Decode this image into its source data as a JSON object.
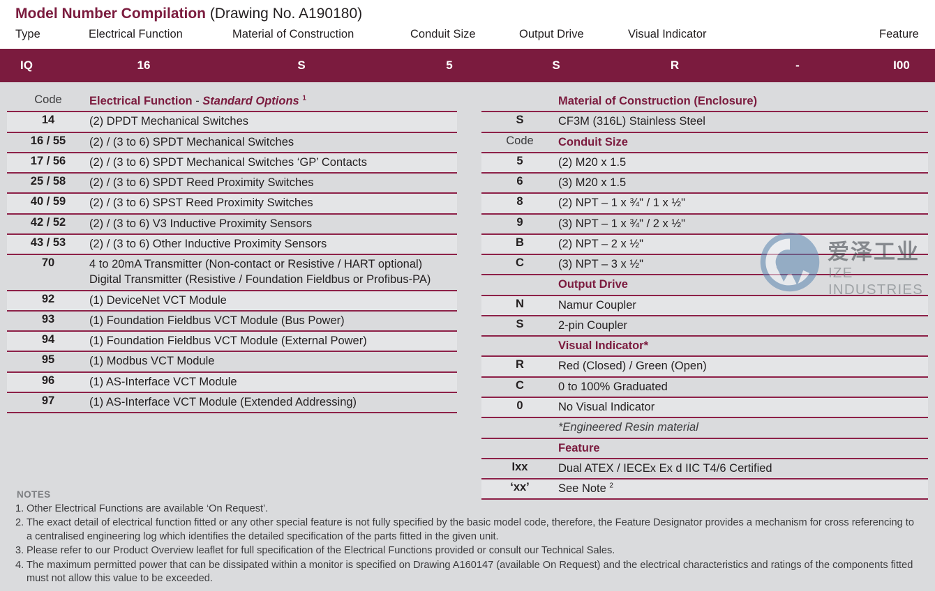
{
  "header": {
    "title_main": "Model Number Compilation",
    "title_sub": "(Drawing No. A190180)",
    "columns": [
      {
        "label": "Type",
        "code": "IQ"
      },
      {
        "label": "Electrical Function",
        "code": "16"
      },
      {
        "label": "Material of Construction",
        "code": "S"
      },
      {
        "label": "Conduit Size",
        "code": "5"
      },
      {
        "label": "Output Drive",
        "code": "S"
      },
      {
        "label": "Visual Indicator",
        "code": "R"
      },
      {
        "label": "",
        "code": "-"
      },
      {
        "label": "Feature",
        "code": "I00"
      }
    ]
  },
  "left_table": {
    "code_label": "Code",
    "section_title": "Electrical Function",
    "section_dash": " - ",
    "section_italic": "Standard Options",
    "section_footnote": "1",
    "rows": [
      {
        "code": "14",
        "desc": "(2) DPDT Mechanical Switches"
      },
      {
        "code": "16 / 55",
        "desc": "(2) / (3 to 6) SPDT Mechanical Switches"
      },
      {
        "code": "17 / 56",
        "desc": "(2) / (3 to 6) SPDT Mechanical Switches ‘GP’ Contacts"
      },
      {
        "code": "25 / 58",
        "desc": "(2) / (3 to 6) SPDT Reed Proximity Switches"
      },
      {
        "code": "40 / 59",
        "desc": "(2) / (3 to 6) SPST Reed Proximity Switches"
      },
      {
        "code": "42 / 52",
        "desc": "(2) / (3 to 6) V3 Inductive Proximity Sensors"
      },
      {
        "code": "43 / 53",
        "desc": "(2) / (3 to 6) Other Inductive Proximity Sensors"
      },
      {
        "code": "70",
        "desc": "4 to 20mA Transmitter (Non-contact or Resistive / HART optional)\nDigital Transmitter (Resistive / Foundation Fieldbus or Profibus-PA)"
      },
      {
        "code": "92",
        "desc": "(1) DeviceNet VCT Module"
      },
      {
        "code": "93",
        "desc": "(1) Foundation Fieldbus VCT Module (Bus Power)"
      },
      {
        "code": "94",
        "desc": "(1) Foundation Fieldbus VCT Module (External Power)"
      },
      {
        "code": "95",
        "desc": "(1) Modbus VCT Module"
      },
      {
        "code": "96",
        "desc": "(1) AS-Interface VCT Module"
      },
      {
        "code": "97",
        "desc": "(1) AS-Interface VCT Module (Extended Addressing)"
      }
    ]
  },
  "right_table": {
    "code_label": "Code",
    "sections": [
      {
        "title": "Material of Construction (Enclosure)",
        "rows": [
          {
            "code": "S",
            "desc": "CF3M (316L) Stainless Steel"
          }
        ]
      },
      {
        "title": "Conduit Size",
        "show_code_label": true,
        "rows": [
          {
            "code": "5",
            "desc": "(2) M20 x 1.5"
          },
          {
            "code": "6",
            "desc": "(3) M20 x 1.5"
          },
          {
            "code": "8",
            "desc": "(2) NPT – 1 x ¾\" / 1 x ½\""
          },
          {
            "code": "9",
            "desc": "(3) NPT – 1 x ¾\" / 2 x ½\""
          },
          {
            "code": "B",
            "desc": "(2) NPT – 2 x ½\""
          },
          {
            "code": "C",
            "desc": "(3) NPT – 3 x ½\""
          }
        ]
      },
      {
        "title": "Output Drive",
        "rows": [
          {
            "code": "N",
            "desc": "Namur Coupler"
          },
          {
            "code": "S",
            "desc": "2-pin Coupler"
          }
        ]
      },
      {
        "title": "Visual Indicator",
        "title_star": "*",
        "rows": [
          {
            "code": "R",
            "desc": "Red (Closed) / Green (Open)"
          },
          {
            "code": "C",
            "desc": "0 to 100% Graduated"
          },
          {
            "code": "0",
            "desc": "No Visual Indicator"
          }
        ],
        "footer_italic": "*Engineered Resin material"
      },
      {
        "title": "Feature",
        "rows": [
          {
            "code": "Ixx",
            "desc": "Dual ATEX / IECEx Ex d IIC T4/6 Certified"
          },
          {
            "code": "‘xx’",
            "desc": "See Note ",
            "desc_sup": "2"
          }
        ]
      }
    ]
  },
  "notes": {
    "heading": "NOTES",
    "items": [
      {
        "num": "1.",
        "text": "Other Electrical Functions are available ‘On Request’."
      },
      {
        "num": "2.",
        "text": "The exact detail of electrical function fitted or any other special feature is not fully specified by the basic model code, therefore, the Feature Designator provides a mechanism for cross referencing to a centralised engineering log which identifies the detailed specification of the parts fitted in the given unit."
      },
      {
        "num": "3.",
        "text": "Please refer to our Product Overview leaflet for full specification of the Electrical Functions provided or consult our Technical Sales."
      },
      {
        "num": "4.",
        "text": "The maximum permitted power that can be dissipated within a monitor is specified on Drawing A160147 (available On Request) and the electrical characteristics and ratings of the components fitted must not allow this value to be exceeded."
      }
    ]
  },
  "watermark": {
    "cn_text": "爱泽工业",
    "en_text": "IZE INDUSTRIES",
    "color": "#5b86b0"
  },
  "colors": {
    "accent": "#7b1b3e",
    "rule": "#8d2148",
    "page_bg": "#dadbdd",
    "row_shade": "#e4e5e7"
  }
}
